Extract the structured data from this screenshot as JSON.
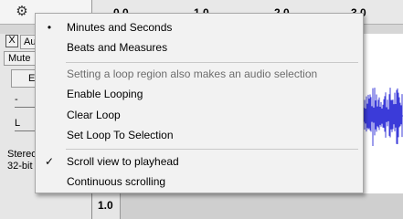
{
  "ruler": {
    "ticks": [
      "0.0",
      "1.0",
      "2.0",
      "3.0"
    ],
    "gear_icon": "gear-icon"
  },
  "track": {
    "close_label": "X",
    "name": "Au",
    "mute_label": "Mute",
    "select_label": "E",
    "gain_label": "-",
    "pan_label": "L",
    "info_line1": "Stereo",
    "info_line2": "32-bit",
    "vruler_label": "1.0",
    "waveform_color": "#3b3bd9"
  },
  "menu": {
    "items": [
      {
        "label": "Minutes and Seconds",
        "mark": "•",
        "enabled": true
      },
      {
        "label": "Beats and Measures",
        "mark": "",
        "enabled": true
      },
      {
        "label": "Setting a loop region also makes an audio selection",
        "mark": "",
        "enabled": false
      },
      {
        "label": "Enable Looping",
        "mark": "",
        "enabled": true
      },
      {
        "label": "Clear Loop",
        "mark": "",
        "enabled": true
      },
      {
        "label": "Set Loop To Selection",
        "mark": "",
        "enabled": true
      },
      {
        "label": "Scroll view to playhead",
        "mark": "✓",
        "enabled": true
      },
      {
        "label": "Continuous scrolling",
        "mark": "",
        "enabled": true
      }
    ]
  }
}
